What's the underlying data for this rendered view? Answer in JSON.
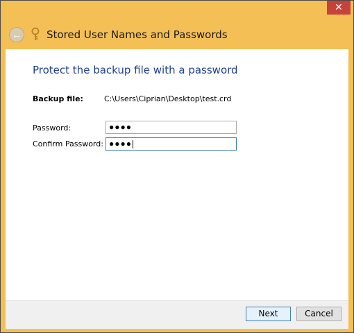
{
  "window": {
    "title": "Stored User Names and Passwords",
    "close_glyph": "✕",
    "back_glyph": "←"
  },
  "main": {
    "heading": "Protect the backup file with a password",
    "backup_file_label": "Backup file:",
    "backup_file_path": "C:\\Users\\Ciprian\\Desktop\\test.crd",
    "password_label": "Password:",
    "password_value": "●●●●",
    "confirm_label": "Confirm Password:",
    "confirm_value": "●●●●"
  },
  "footer": {
    "next_label": "Next",
    "cancel_label": "Cancel"
  },
  "colors": {
    "frame": "#f4bf55",
    "heading": "#1e3f8f",
    "close": "#c7423a",
    "focus_border": "#3c7fb1"
  },
  "icons": [
    "back-arrow-icon",
    "key-icon",
    "close-icon"
  ]
}
